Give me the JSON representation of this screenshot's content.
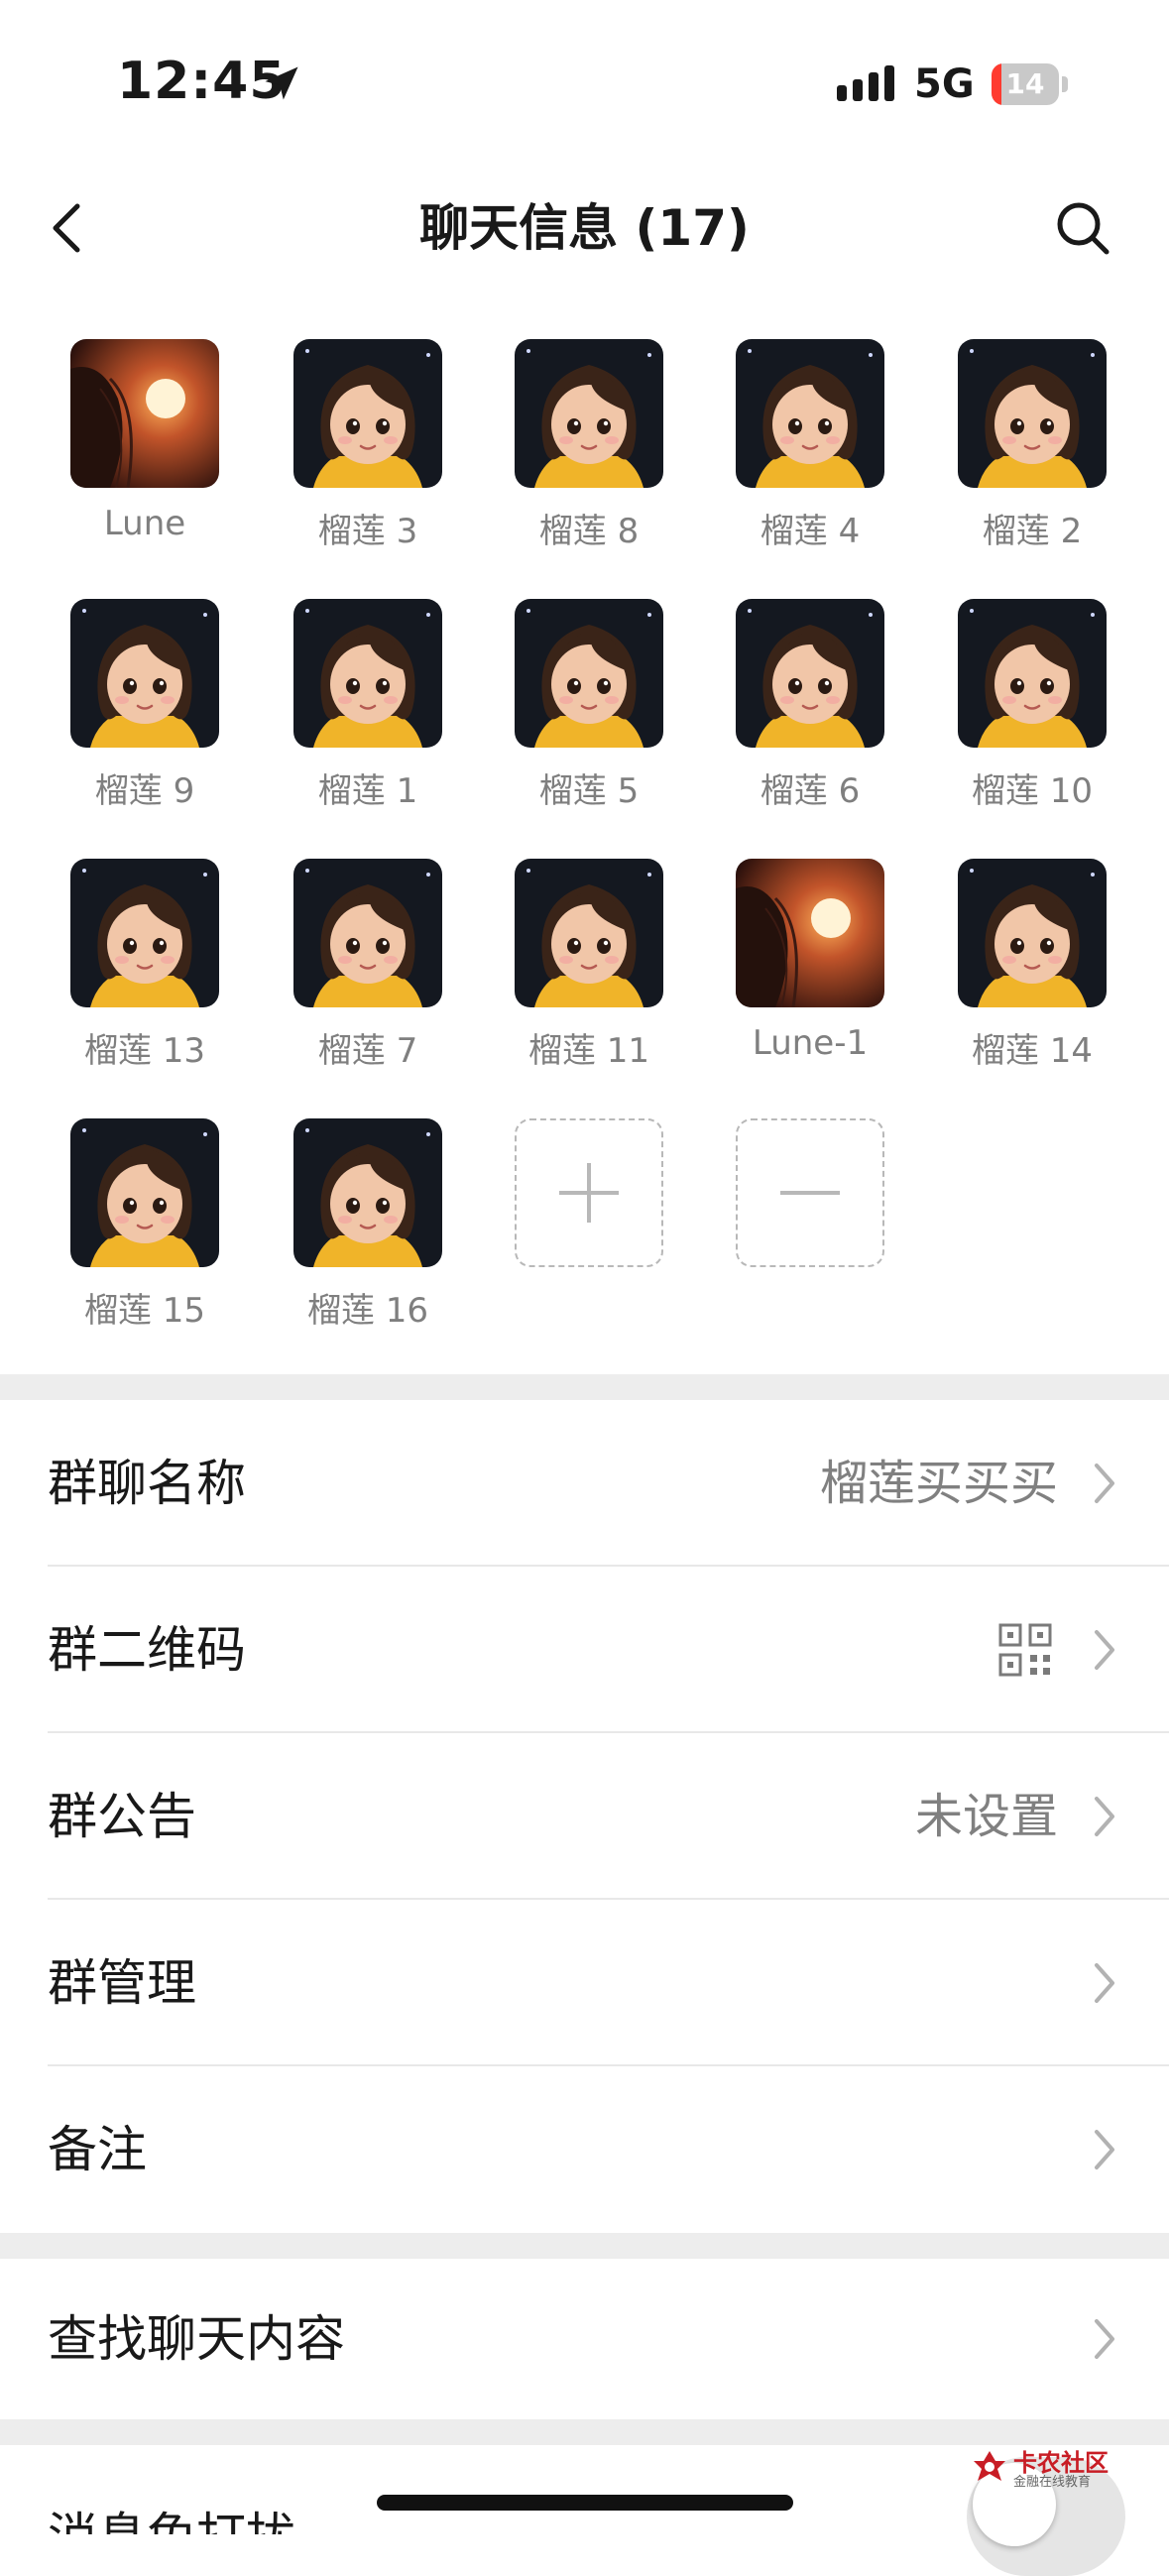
{
  "status_bar": {
    "time": "12:45",
    "network": "5G",
    "battery_level": 14,
    "battery_text": "14"
  },
  "nav": {
    "title": "聊天信息 (17)",
    "back_icon": "chevron-left-icon",
    "search_icon": "search-icon"
  },
  "members": [
    {
      "name": "Lune",
      "avatar": "sunset"
    },
    {
      "name": "榴莲 3",
      "avatar": "cartoon-girl"
    },
    {
      "name": "榴莲 8",
      "avatar": "cartoon-girl"
    },
    {
      "name": "榴莲 4",
      "avatar": "cartoon-girl"
    },
    {
      "name": "榴莲 2",
      "avatar": "cartoon-girl"
    },
    {
      "name": "榴莲 9",
      "avatar": "cartoon-girl"
    },
    {
      "name": "榴莲 1",
      "avatar": "cartoon-girl"
    },
    {
      "name": "榴莲 5",
      "avatar": "cartoon-girl"
    },
    {
      "name": "榴莲 6",
      "avatar": "cartoon-girl"
    },
    {
      "name": "榴莲 10",
      "avatar": "cartoon-girl"
    },
    {
      "name": "榴莲 13",
      "avatar": "cartoon-girl"
    },
    {
      "name": "榴莲 7",
      "avatar": "cartoon-girl"
    },
    {
      "name": "榴莲 11",
      "avatar": "cartoon-girl"
    },
    {
      "name": "Lune-1",
      "avatar": "sunset"
    },
    {
      "name": "榴莲 14",
      "avatar": "cartoon-girl"
    },
    {
      "name": "榴莲 15",
      "avatar": "cartoon-girl"
    },
    {
      "name": "榴莲 16",
      "avatar": "cartoon-girl"
    }
  ],
  "member_actions": {
    "add_icon": "plus-icon",
    "remove_icon": "minus-icon"
  },
  "settings": {
    "group_name_label": "群聊名称",
    "group_name_value": "榴莲买买买",
    "qr_label": "群二维码",
    "qr_icon": "qr-code-icon",
    "notice_label": "群公告",
    "notice_value": "未设置",
    "manage_label": "群管理",
    "remark_label": "备注",
    "search_chat_label": "查找聊天内容",
    "mute_label": "消息免打扰"
  },
  "watermark": {
    "title": "卡农社区",
    "subtitle": "金融在线教育"
  },
  "colors": {
    "text": "#191919",
    "secondary": "#808080",
    "separator": "#ededed",
    "battery_low": "#ff3b30",
    "watermark": "#c81d25"
  }
}
